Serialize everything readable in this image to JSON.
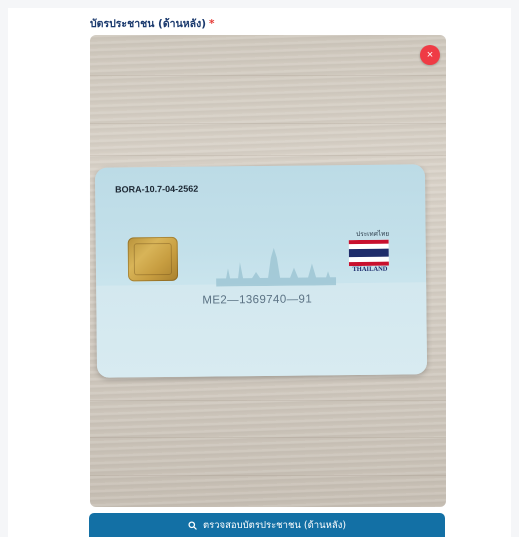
{
  "field": {
    "label": "บัตรประชาชน (ด้านหลัง)",
    "required_mark": "*"
  },
  "preview": {
    "remove_icon": "close-icon",
    "remove_glyph": "×"
  },
  "card": {
    "code": "BORA-10.7-04-2562",
    "country_thai": "ประเทศไทย",
    "country_en": "THAILAND",
    "serial": "ME2—1369740—91"
  },
  "action": {
    "verify_label": "ตรวจสอบบัตรประชาชน (ด้านหลัง)",
    "icon": "search-icon"
  },
  "colors": {
    "primary": "#1370a5",
    "danger": "#ef3b45",
    "label": "#1b3a6e"
  }
}
